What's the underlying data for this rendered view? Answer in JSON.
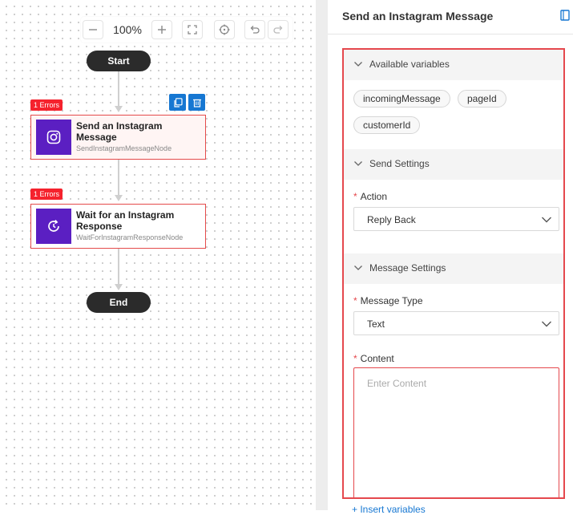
{
  "toolbar": {
    "zoom": "100%"
  },
  "flow": {
    "start": "Start",
    "end": "End",
    "nodes": [
      {
        "error": "1 Errors",
        "title": "Send an Instagram Message",
        "subtitle": "SendInstagramMessageNode"
      },
      {
        "error": "1 Errors",
        "title": "Wait for an Instagram Response",
        "subtitle": "WaitForInstagramResponseNode"
      }
    ]
  },
  "panel": {
    "title": "Send an Instagram Message",
    "sections": {
      "variables": "Available variables",
      "send": "Send Settings",
      "message": "Message Settings"
    },
    "variables": [
      "incomingMessage",
      "pageId",
      "customerId"
    ],
    "action": {
      "label": "Action",
      "value": "Reply Back"
    },
    "message_type": {
      "label": "Message Type",
      "value": "Text"
    },
    "content": {
      "label": "Content",
      "placeholder": "Enter Content"
    },
    "insert_link": "+ Insert variables"
  },
  "colors": {
    "accent": "#1677d2",
    "error": "#e5484d",
    "node_icon": "#5b1fc2"
  }
}
